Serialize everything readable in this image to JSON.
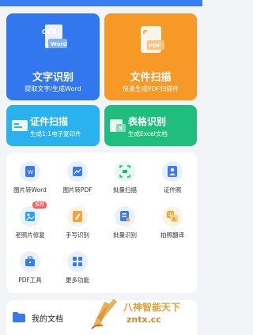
{
  "cards": {
    "text": {
      "title": "文字识别",
      "subtitle": "提取文字/生成Word",
      "icon_word": "Word",
      "icon_ocr": "OCR"
    },
    "scan": {
      "title": "文件扫描",
      "subtitle": "快速生成PDF扫描件",
      "icon_pdf": "PDF"
    },
    "id": {
      "title": "证件扫描",
      "subtitle": "生成1:1电子复印件"
    },
    "table": {
      "title": "表格识别",
      "subtitle": "生成Excel文档"
    }
  },
  "tools": [
    {
      "label": "图片转Word",
      "icon": "word-doc-icon",
      "color": "#3a79f0"
    },
    {
      "label": "图片转PDF",
      "icon": "image-pdf-icon",
      "color": "#3a79f0"
    },
    {
      "label": "批量扫描",
      "icon": "scan-frame-icon",
      "color": "#22b573"
    },
    {
      "label": "证件照",
      "icon": "id-photo-icon",
      "color": "#3a79f0"
    },
    {
      "label": "老照片修复",
      "icon": "photo-restore-icon",
      "color": "#2da1f0",
      "badge": "推荐"
    },
    {
      "label": "手写识别",
      "icon": "handwriting-icon",
      "color": "#f5a33a"
    },
    {
      "label": "批量识别",
      "icon": "batch-recognize-icon",
      "color": "#3a79f0"
    },
    {
      "label": "拍照翻译",
      "icon": "translate-icon",
      "color": "#f5a33a"
    },
    {
      "label": "PDF工具",
      "icon": "toolbox-icon",
      "color": "#3a79f0"
    },
    {
      "label": "更多功能",
      "icon": "more-grid-icon",
      "color": "#3a79f0"
    }
  ],
  "bottom": {
    "label": "我的文档"
  },
  "watermark": {
    "title": "八神智能天下",
    "url": "zntx.cc"
  }
}
